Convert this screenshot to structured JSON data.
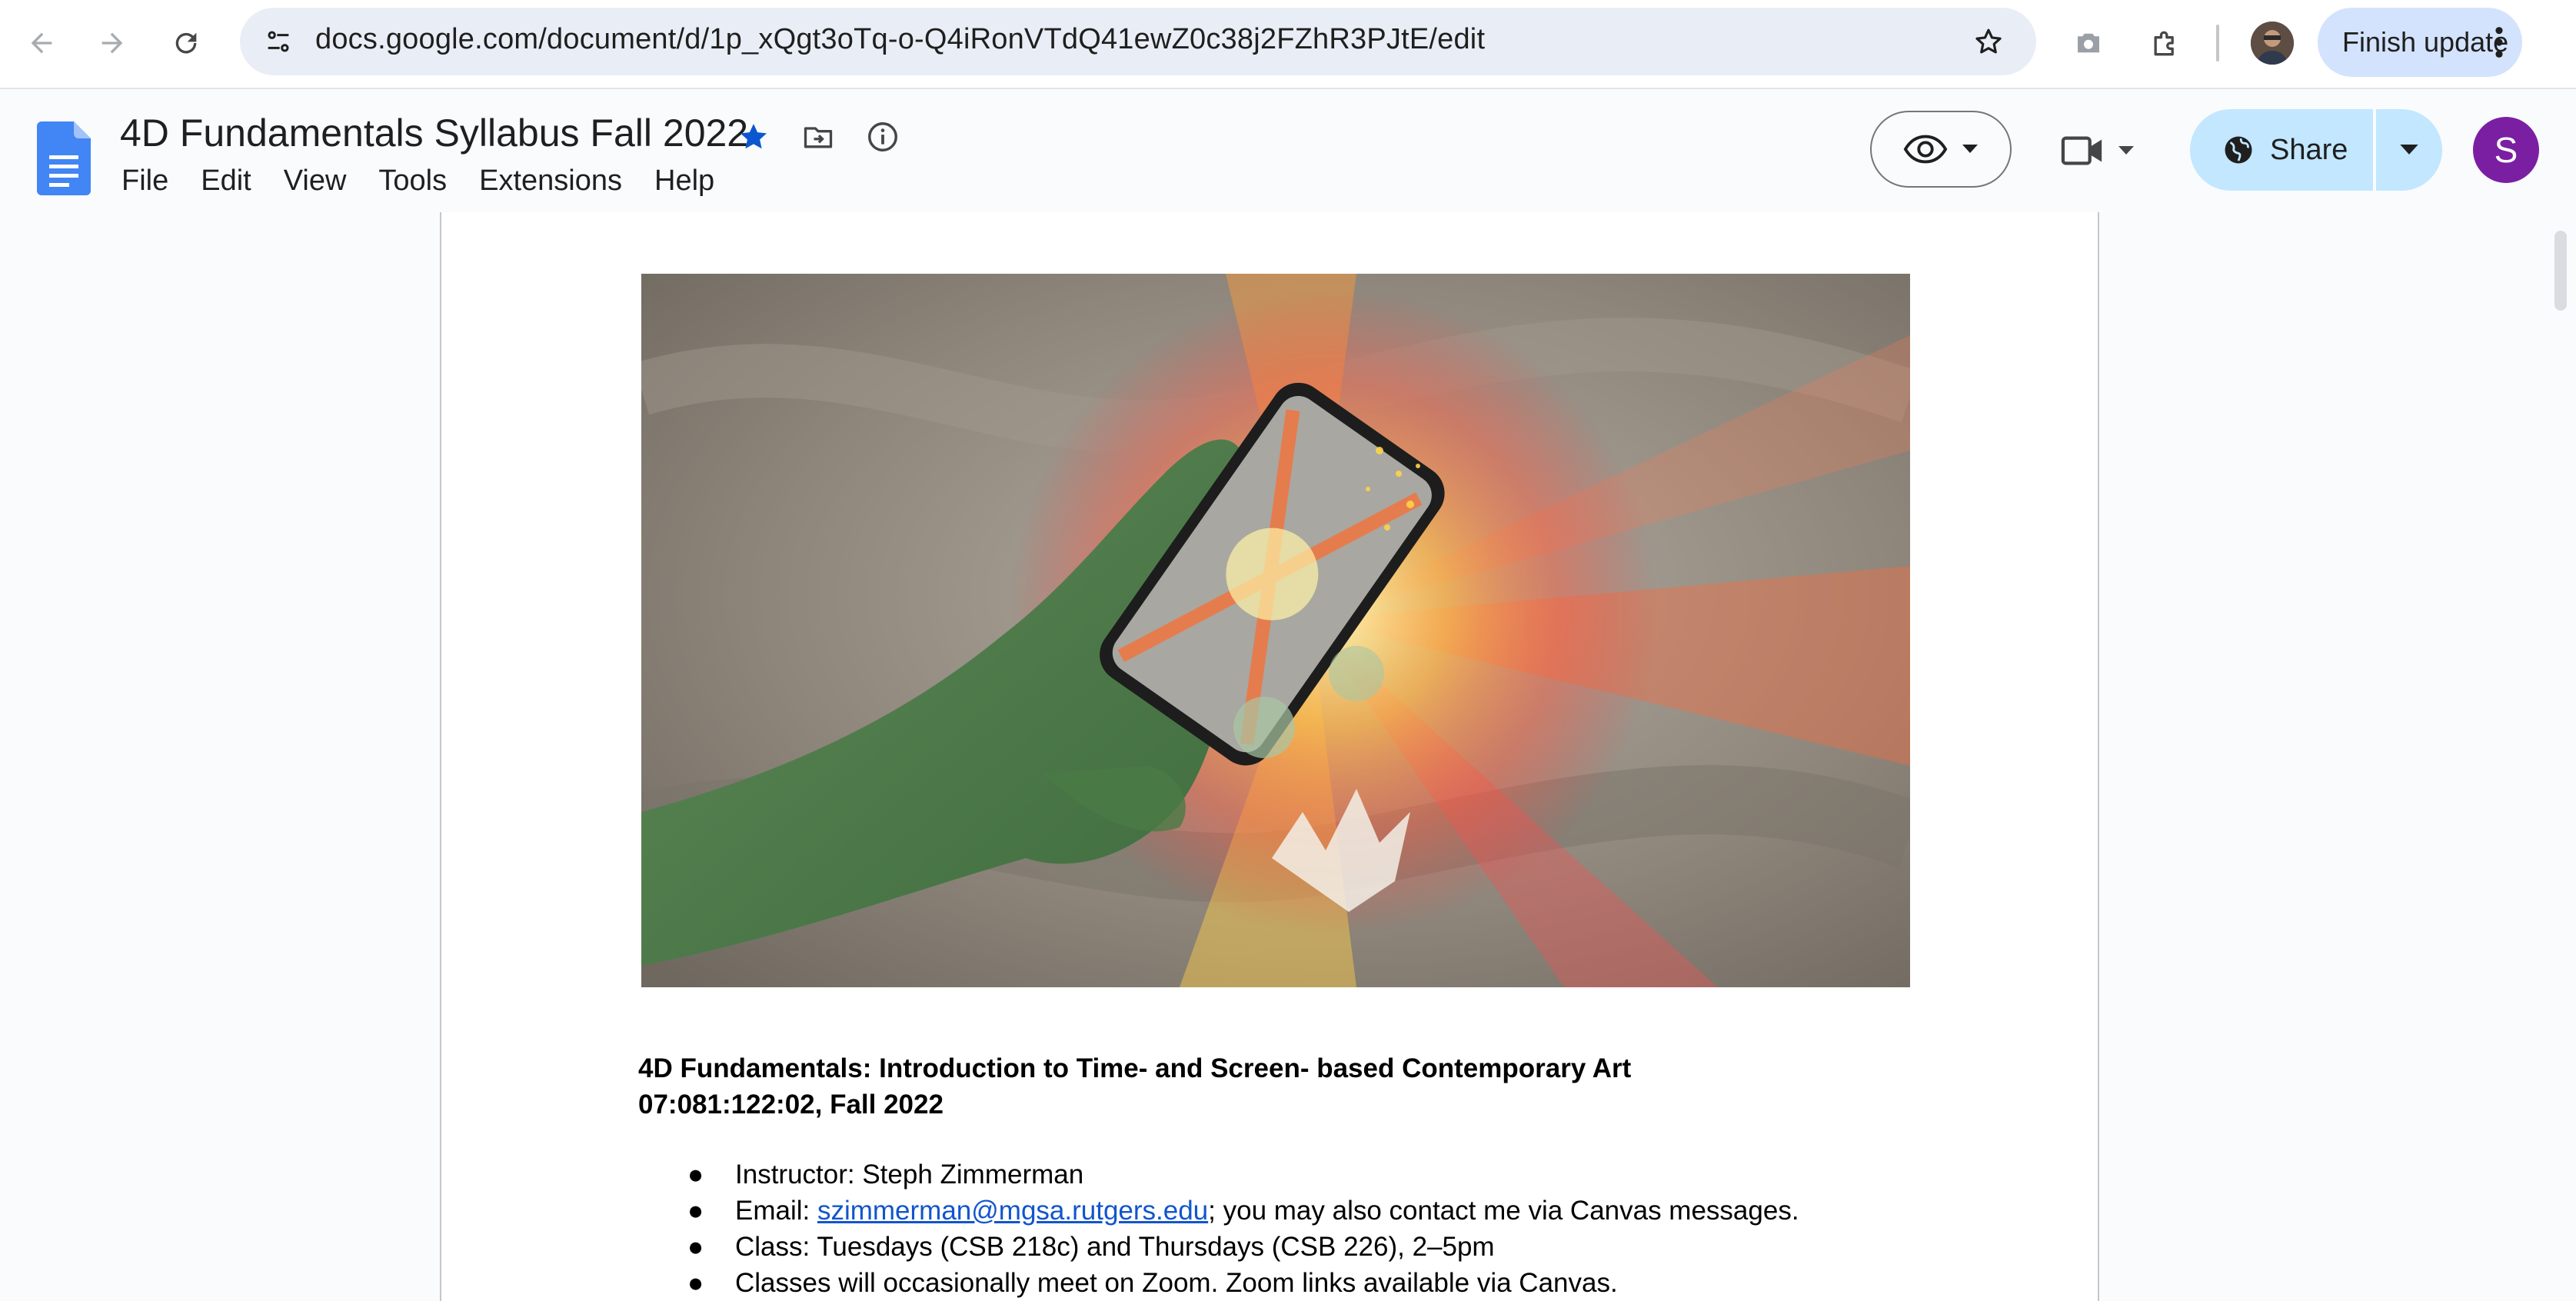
{
  "browser": {
    "url": "docs.google.com/document/d/1p_xQgt3oTq-o-Q4iRonVTdQ41ewZ0c38j2FZhR3PJtE/edit",
    "finish_update_label": "Finish update"
  },
  "doc": {
    "title": "4D Fundamentals Syllabus Fall 2022",
    "menu": [
      "File",
      "Edit",
      "View",
      "Tools",
      "Extensions",
      "Help"
    ],
    "share_label": "Share",
    "account_initial": "S"
  },
  "content": {
    "heading_line1": "4D Fundamentals: Introduction to Time- and Screen- based Contemporary Art",
    "heading_line2": "07:081:122:02, Fall 2022",
    "bullet": "●",
    "items": [
      {
        "text": "Instructor: Steph Zimmerman"
      },
      {
        "prefix": "Email: ",
        "link": "szimmerman@mgsa.rutgers.edu",
        "suffix": "; you may also contact me via Canvas messages."
      },
      {
        "text": "Class: Tuesdays (CSB 218c) and Thursdays (CSB 226), 2–5pm"
      },
      {
        "text": "Classes will occasionally meet on Zoom. Zoom links available via Canvas."
      }
    ]
  },
  "colors": {
    "accent": "#0b57d0",
    "share_bg": "#c2e7ff",
    "avatar_bg": "#7b1fa2",
    "link": "#1155cc"
  }
}
